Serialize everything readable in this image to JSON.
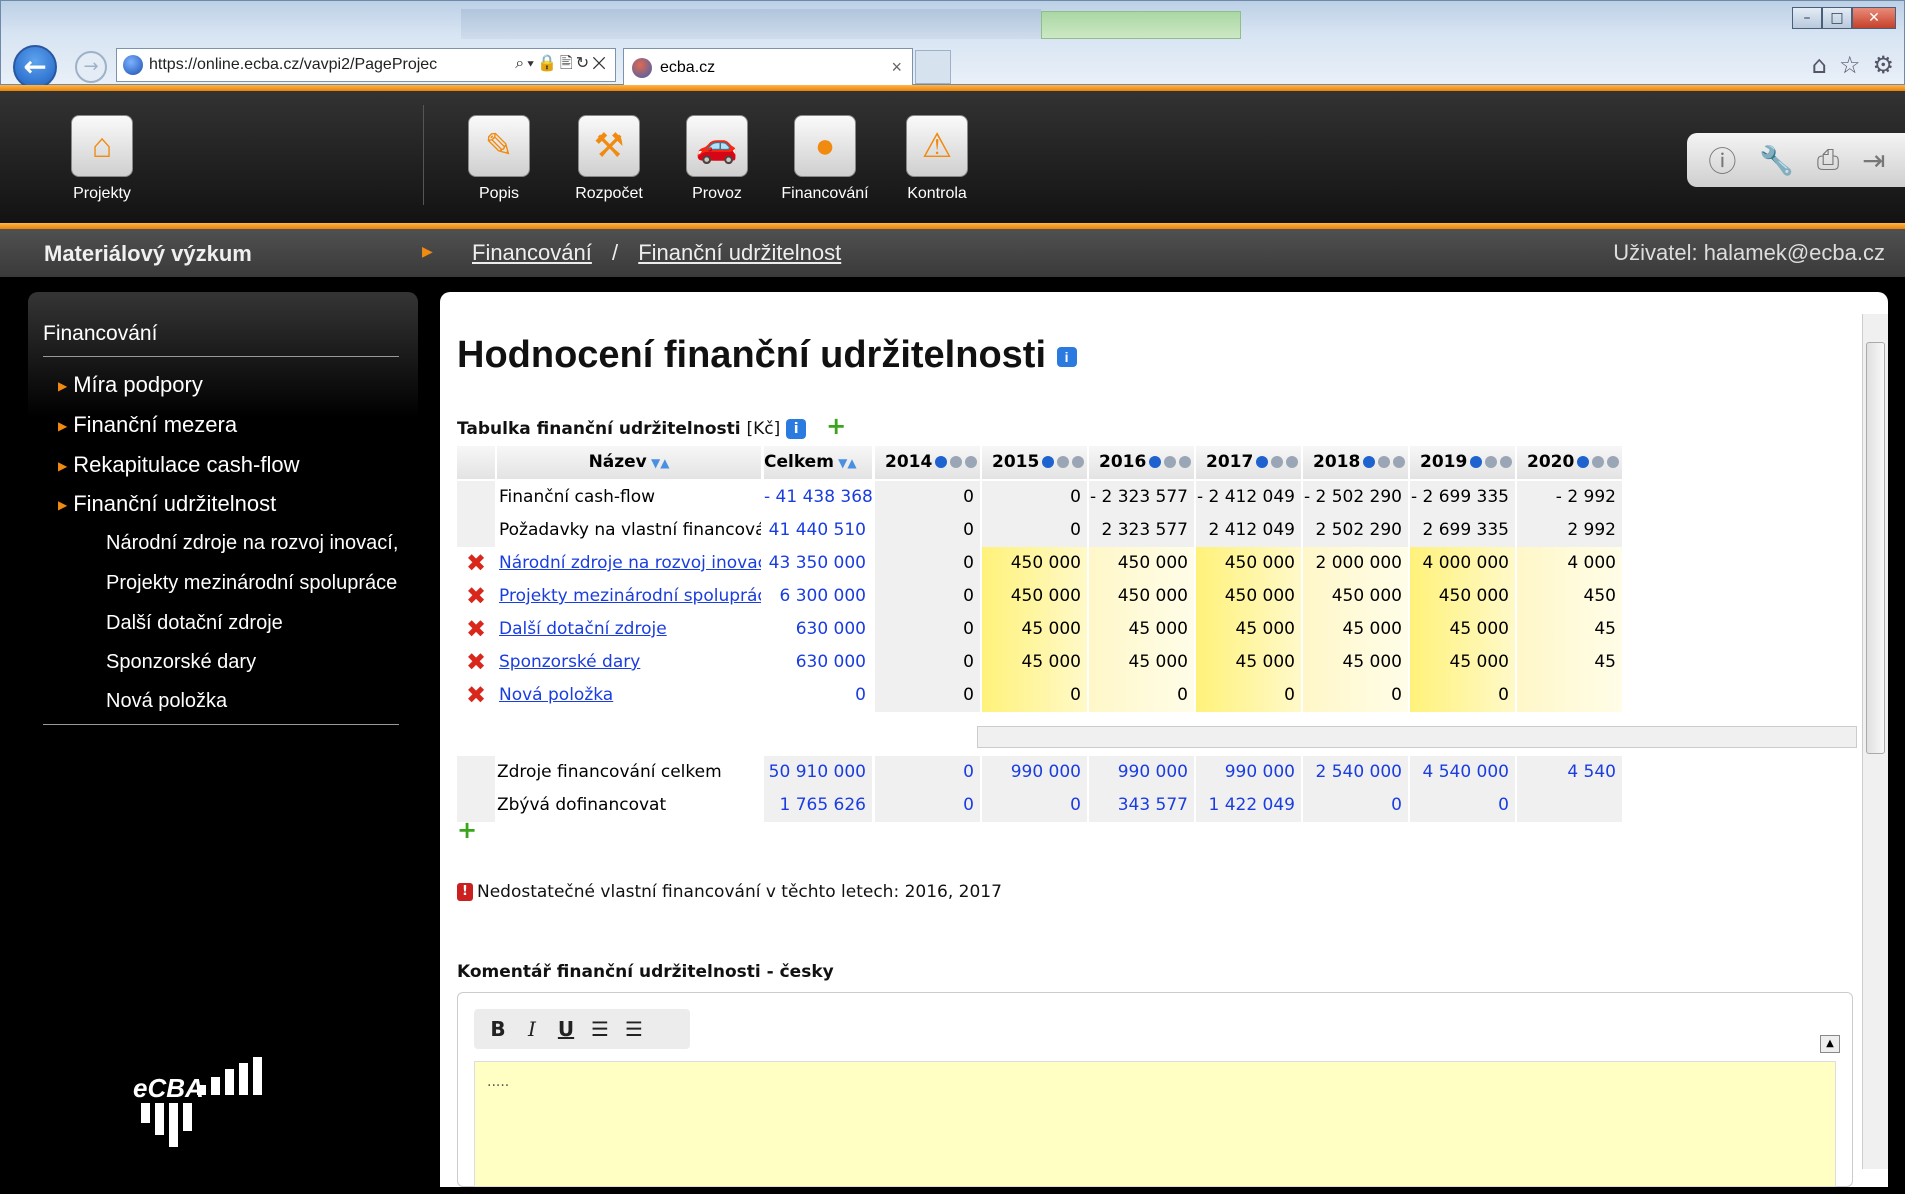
{
  "browser": {
    "url": "https://online.ecba.cz/vavpi2/PageProjec",
    "tab_title": "ecba.cz",
    "tab_close": "×",
    "addr_tools": "⌕▾🔒🖹↻✕"
  },
  "nav": {
    "projekty": "Projekty",
    "popis": "Popis",
    "rozpocet": "Rozpočet",
    "provoz": "Provoz",
    "financovani": "Financování",
    "kontrola": "Kontrola"
  },
  "breadcrumb": {
    "project": "Materiálový výzkum",
    "level1": "Financování",
    "separator": "/",
    "level2": "Finanční udržitelnost",
    "user": "Uživatel: halamek@ecba.cz"
  },
  "sidebar": {
    "title": "Financování",
    "items": [
      "Míra podpory",
      "Finanční mezera",
      "Rekapitulace cash-flow",
      "Finanční udržitelnost"
    ],
    "subitems": [
      "Národní zdroje na rozvoj inovací,",
      "Projekty mezinárodní spolupráce",
      "Další dotační zdroje",
      "Sponzorské dary",
      "Nová položka"
    ],
    "logo_text": "eCBA"
  },
  "main": {
    "title": "Hodnocení finanční udržitelnosti",
    "table_label": "Tabulka finanční udržitelnosti",
    "table_unit": "[Kč]",
    "warning": "Nedostatečné vlastní financování v těchto letech: 2016, 2017",
    "comment_label": "Komentář finanční udržitelnosti - česky",
    "comment_text": ".....",
    "col_name": "Název",
    "col_total": "Celkem",
    "years": [
      "2014",
      "2015",
      "2016",
      "2017",
      "2018",
      "2019",
      "2020"
    ],
    "rows": [
      {
        "name": "Finanční cash-flow",
        "total": "- 41 438 368",
        "vals": [
          "0",
          "0",
          "- 2 323 577",
          "- 2 412 049",
          "- 2 502 290",
          "- 2 699 335",
          "- 2 992 "
        ]
      },
      {
        "name": "Požadavky na vlastní financování",
        "total": "41 440 510",
        "vals": [
          "0",
          "0",
          "2 323 577",
          "2 412 049",
          "2 502 290",
          "2 699 335",
          "2 992 "
        ]
      },
      {
        "name": "Národní zdroje na rozvoj inovací, znalo",
        "total": "43 350 000",
        "vals": [
          "0",
          "450 000",
          "450 000",
          "450 000",
          "2 000 000",
          "4 000 000",
          "4 000 "
        ]
      },
      {
        "name": "Projekty mezinárodní spolupráce",
        "total": "6 300 000",
        "vals": [
          "0",
          "450 000",
          "450 000",
          "450 000",
          "450 000",
          "450 000",
          "450 "
        ]
      },
      {
        "name": "Další dotační zdroje",
        "total": "630 000",
        "vals": [
          "0",
          "45 000",
          "45 000",
          "45 000",
          "45 000",
          "45 000",
          "45 "
        ]
      },
      {
        "name": "Sponzorské dary",
        "total": "630 000",
        "vals": [
          "0",
          "45 000",
          "45 000",
          "45 000",
          "45 000",
          "45 000",
          "45 "
        ]
      },
      {
        "name": "Nová položka",
        "total": "0",
        "vals": [
          "0",
          "0",
          "0",
          "0",
          "0",
          "0",
          ""
        ]
      }
    ],
    "summary": [
      {
        "name": "Zdroje financování celkem",
        "total": "50 910 000",
        "vals": [
          "0",
          "990 000",
          "990 000",
          "990 000",
          "2 540 000",
          "4 540 000",
          "4 540 "
        ]
      },
      {
        "name": "Zbývá dofinancovat",
        "total": "1 765 626",
        "vals": [
          "0",
          "0",
          "343 577",
          "1 422 049",
          "0",
          "0",
          ""
        ]
      }
    ]
  },
  "editor": {
    "bold": "B",
    "italic": "I",
    "underline": "U"
  },
  "colors": {
    "accent": "#f08a10",
    "link": "#1a3de0",
    "delete": "#d9271c"
  }
}
